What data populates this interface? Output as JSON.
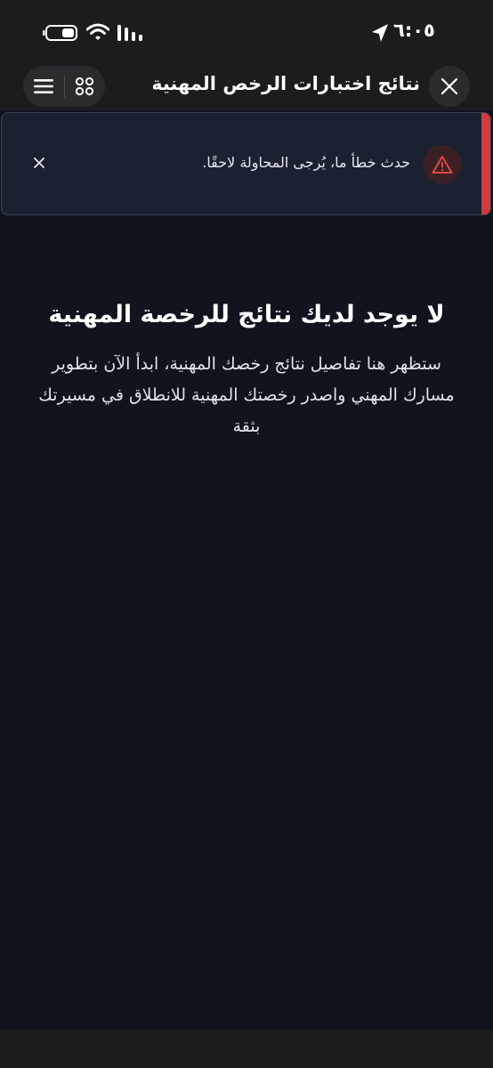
{
  "status_bar": {
    "time": "٦:٠٥",
    "icons": [
      "battery-icon",
      "wifi-icon",
      "cellular-signal-icon",
      "location-arrow-icon"
    ]
  },
  "toolbar": {
    "title": "نتائج اختبارات الرخص المهنية لدى هـ...",
    "icons": [
      "close-icon",
      "hamburger-menu-icon",
      "apps-grid-icon"
    ]
  },
  "alert": {
    "message": "حدث خطأ ما، يُرجى المحاولة لاحقًا.",
    "icon": "warning-triangle-icon",
    "accent_color": "#d13b3b"
  },
  "empty_state": {
    "title": "لا يوجد لديك نتائج للرخصة المهنية",
    "description": "ستظهر هنا تفاصيل نتائج رخصك المهنية، ابدأ الآن بتطوير مسارك المهني واصدر رخصتك المهنية للانطلاق في مسيرتك بثقة"
  },
  "colors": {
    "background": "#0f141e",
    "bar": "#1c1c1e",
    "alert_bg": "#1a2231"
  }
}
